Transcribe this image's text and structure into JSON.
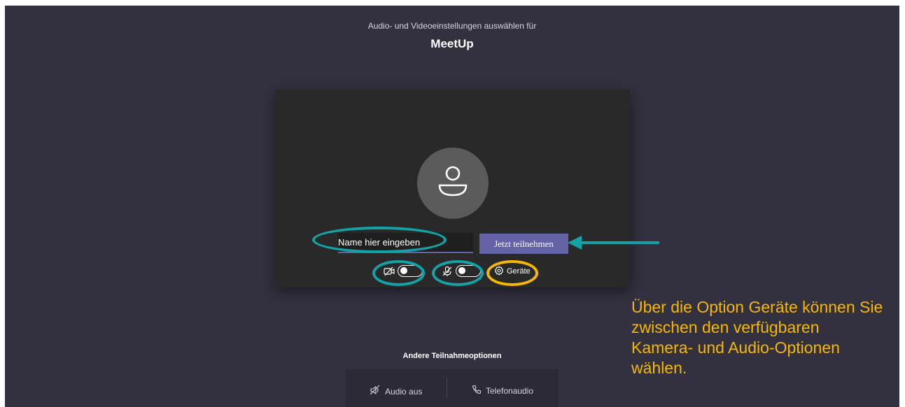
{
  "header": {
    "subtitle": "Audio- und Videoeinstellungen auswählen für",
    "meeting_title": "MeetUp"
  },
  "prejoin": {
    "name_input_value": "Name hier eingeben",
    "join_button": "Jetzt teilnehmen",
    "camera_toggle": {
      "icon": "camera-off-icon",
      "state": "off"
    },
    "mic_toggle": {
      "icon": "mic-off-icon",
      "state": "off"
    },
    "devices_label": "Geräte",
    "devices_icon": "gear-icon"
  },
  "other_options": {
    "title": "Andere Teilnahmeoptionen",
    "items": [
      {
        "label": "Audio aus",
        "icon": "speaker-off-icon"
      },
      {
        "label": "Telefonaudio",
        "icon": "phone-icon"
      }
    ]
  },
  "annotation": {
    "text": "Über die Option Geräte können Sie zwischen den verfügbaren Kamera- und Audio-Optionen wählen."
  },
  "colors": {
    "background": "#33313f",
    "panel": "#292929",
    "accent": "#6264a7",
    "highlight_teal": "#12a3a7",
    "highlight_gold": "#f5b800"
  }
}
